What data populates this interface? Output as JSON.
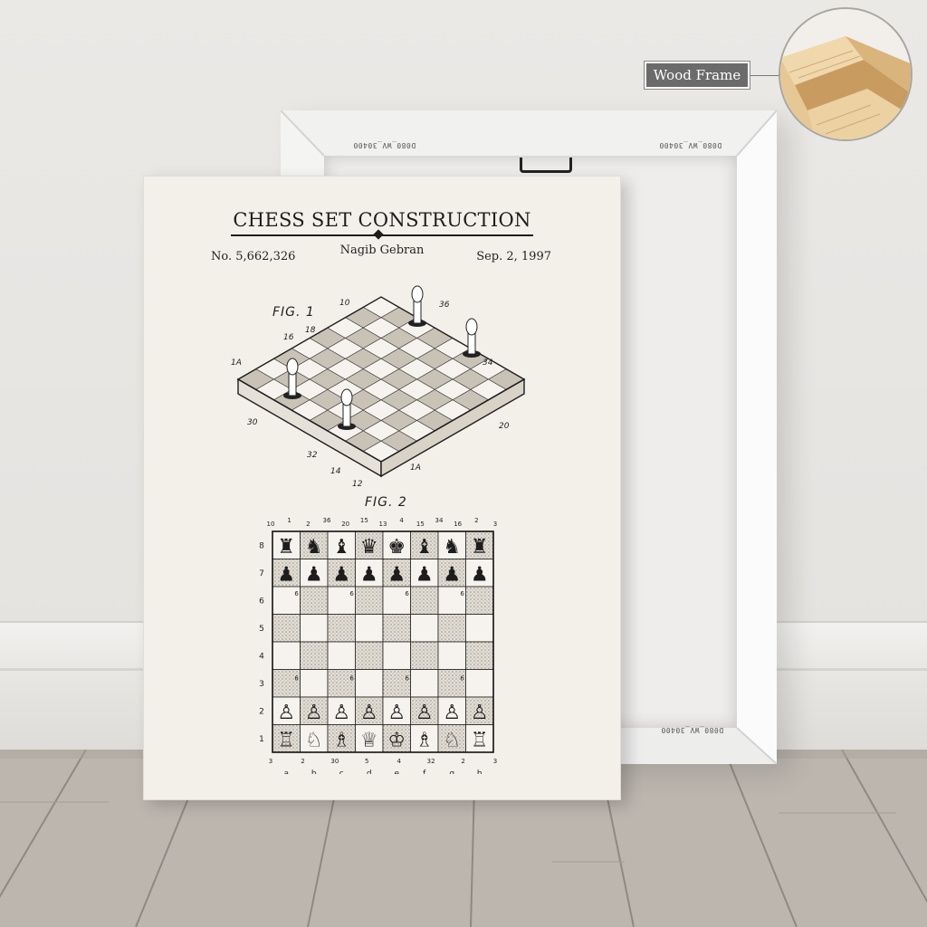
{
  "badge": {
    "label": "Wood Frame"
  },
  "canvas_back": {
    "stamps": [
      "D080_WV_30400",
      "D080_WV_30400",
      "D080_WV_30400"
    ]
  },
  "poster": {
    "title": "CHESS SET CONSTRUCTION",
    "inventor": "Nagib Gebran",
    "patent_number": "No. 5,662,326",
    "date": "Sep. 2, 1997",
    "fig1": {
      "label": "FIG. 1",
      "callouts": [
        "10",
        "36",
        "18",
        "16",
        "34",
        "1A",
        "30",
        "20",
        "32",
        "14",
        "12",
        "1A"
      ]
    },
    "fig2": {
      "label": "FIG. 2",
      "ranks": [
        "8",
        "7",
        "6",
        "5",
        "4",
        "3",
        "2",
        "1"
      ],
      "files": [
        "a",
        "b",
        "c",
        "d",
        "e",
        "f",
        "g",
        "h"
      ],
      "top_callouts": [
        "10",
        "1",
        "2",
        "36",
        "20",
        "15",
        "13",
        "4",
        "15",
        "34",
        "16",
        "2",
        "3"
      ],
      "bottom_callouts": [
        "3",
        "2",
        "30",
        "5",
        "4",
        "32",
        "2",
        "3"
      ],
      "pawn_callout": "6",
      "back_rank_black": [
        "♜",
        "♞",
        "♝",
        "♛",
        "♚",
        "♝",
        "♞",
        "♜"
      ],
      "back_rank_white": [
        "♖",
        "♘",
        "♗",
        "♕",
        "♔",
        "♗",
        "♘",
        "♖"
      ],
      "pawn_black": "♟",
      "pawn_white": "♙"
    }
  },
  "colors": {
    "wall": "#e9e7e4",
    "paper": "#f3f0ea",
    "ink": "#1d1d1d",
    "floor": "#b9b3ac",
    "wood": "#e0c08e"
  }
}
